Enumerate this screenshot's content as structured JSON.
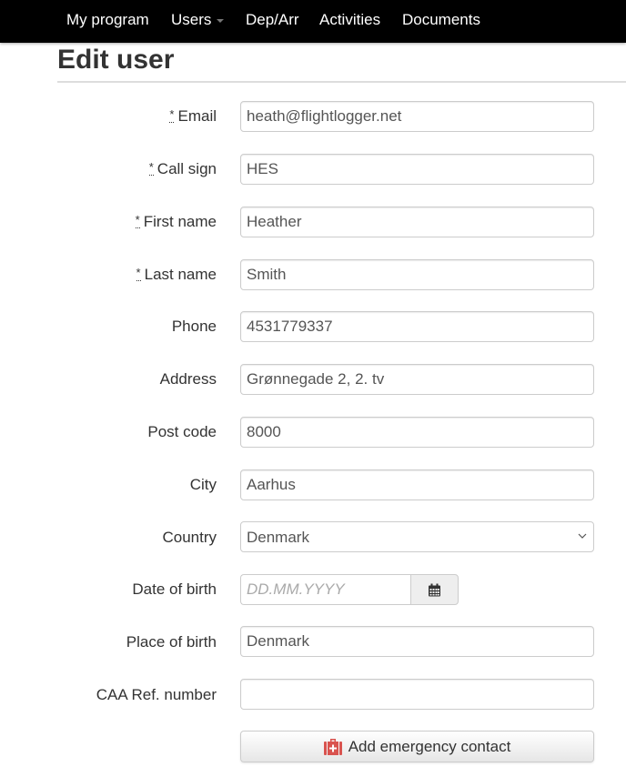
{
  "nav": {
    "items": [
      {
        "label": "My program"
      },
      {
        "label": "Users",
        "has_dropdown": true
      },
      {
        "label": "Dep/Arr"
      },
      {
        "label": "Activities"
      },
      {
        "label": "Documents"
      }
    ]
  },
  "page": {
    "title": "Edit user"
  },
  "form": {
    "required_marker": "*",
    "email": {
      "label": "Email",
      "required": true,
      "value": "heath@flightlogger.net"
    },
    "call_sign": {
      "label": "Call sign",
      "required": true,
      "value": "HES"
    },
    "first_name": {
      "label": "First name",
      "required": true,
      "value": "Heather"
    },
    "last_name": {
      "label": "Last name",
      "required": true,
      "value": "Smith"
    },
    "phone": {
      "label": "Phone",
      "value": "4531779337"
    },
    "address": {
      "label": "Address",
      "value": "Grønnegade 2, 2. tv"
    },
    "post_code": {
      "label": "Post code",
      "value": "8000"
    },
    "city": {
      "label": "City",
      "value": "Aarhus"
    },
    "country": {
      "label": "Country",
      "selected": "Denmark"
    },
    "date_of_birth": {
      "label": "Date of birth",
      "value": "",
      "placeholder": "DD.MM.YYYY",
      "icon": "calendar-icon"
    },
    "place_of_birth": {
      "label": "Place of birth",
      "value": "Denmark"
    },
    "caa_ref": {
      "label": "CAA Ref. number",
      "value": ""
    },
    "emergency_button": {
      "label": "Add emergency contact",
      "icon": "medkit-icon",
      "icon_color": "#d9534f"
    }
  }
}
